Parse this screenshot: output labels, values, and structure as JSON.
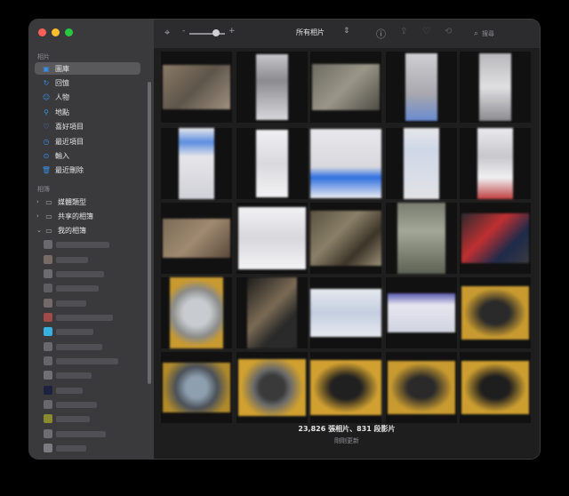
{
  "sidebar": {
    "section_photos": "相片",
    "items": [
      {
        "label": "圖庫",
        "icon": "photo-library-icon"
      },
      {
        "label": "回憶",
        "icon": "memories-icon"
      },
      {
        "label": "人物",
        "icon": "people-icon"
      },
      {
        "label": "地點",
        "icon": "places-icon"
      },
      {
        "label": "喜好項目",
        "icon": "heart-icon"
      },
      {
        "label": "最近項目",
        "icon": "clock-icon"
      },
      {
        "label": "輸入",
        "icon": "import-icon"
      },
      {
        "label": "最近刪除",
        "icon": "trash-icon"
      }
    ],
    "section_albums": "相簿",
    "album_groups": [
      {
        "label": "媒體類型",
        "icon": "media-types-icon"
      },
      {
        "label": "共享的相簿",
        "icon": "shared-albums-icon"
      },
      {
        "label": "我的相簿",
        "icon": "my-albums-icon"
      }
    ]
  },
  "toolbar": {
    "title": "所有相片",
    "search_placeholder": "搜尋",
    "slider_min": "-",
    "slider_max": "+",
    "slider_value": 0.65
  },
  "footer": {
    "count": "23,826 張相片、831 段影片",
    "status": "剛剛更新"
  },
  "colors": {
    "accent": "#3a8ee6",
    "sidebar_bg": "#3a3a3c",
    "main_bg": "#1e1e1e"
  }
}
